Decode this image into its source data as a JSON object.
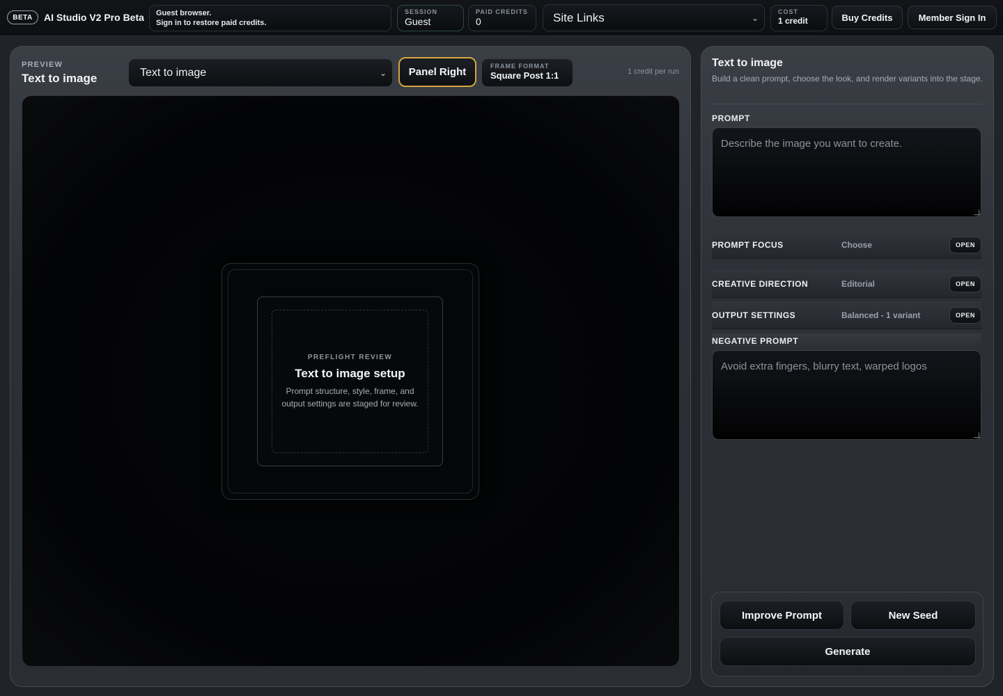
{
  "topbar": {
    "badge": "BETA",
    "app_title": "AI Studio V2 Pro Beta",
    "guest_line1": "Guest browser.",
    "guest_line2": "Sign in to restore paid credits.",
    "session": {
      "label": "SESSION",
      "value": "Guest"
    },
    "paid_credits": {
      "label": "PAID CREDITS",
      "value": "0"
    },
    "site_links": "Site Links",
    "cost": {
      "label": "COST",
      "value": "1 credit"
    },
    "buy_credits": "Buy Credits",
    "member_sign_in": "Member Sign In"
  },
  "preview": {
    "label": "PREVIEW",
    "title": "Text to image",
    "mode_value": "Text to image",
    "panel_toggle": "Panel Right",
    "frame_format": {
      "label": "FRAME FORMAT",
      "value": "Square Post 1:1"
    },
    "credit_note": "1 credit per run",
    "placeholder": {
      "label": "PREFLIGHT REVIEW",
      "title": "Text to image setup",
      "description": "Prompt structure, style, frame, and output settings are staged for review."
    }
  },
  "controls": {
    "title": "Text to image",
    "description": "Build a clean prompt, choose the look, and render variants into the stage.",
    "prompt_label": "PROMPT",
    "prompt_placeholder": "Describe the image you want to create.",
    "rows": [
      {
        "name": "PROMPT FOCUS",
        "value": "Choose",
        "action": "OPEN"
      },
      {
        "name": "CREATIVE DIRECTION",
        "value": "Editorial",
        "action": "OPEN"
      },
      {
        "name": "OUTPUT SETTINGS",
        "value": "Balanced - 1 variant",
        "action": "OPEN"
      }
    ],
    "negative_label": "NEGATIVE PROMPT",
    "negative_placeholder": "Avoid extra fingers, blurry text, warped logos",
    "improve_prompt": "Improve Prompt",
    "new_seed": "New Seed",
    "generate": "Generate"
  },
  "colors": {
    "accent_border": "#d4a640",
    "session_border": "#2c4a44",
    "background": "#202328"
  }
}
